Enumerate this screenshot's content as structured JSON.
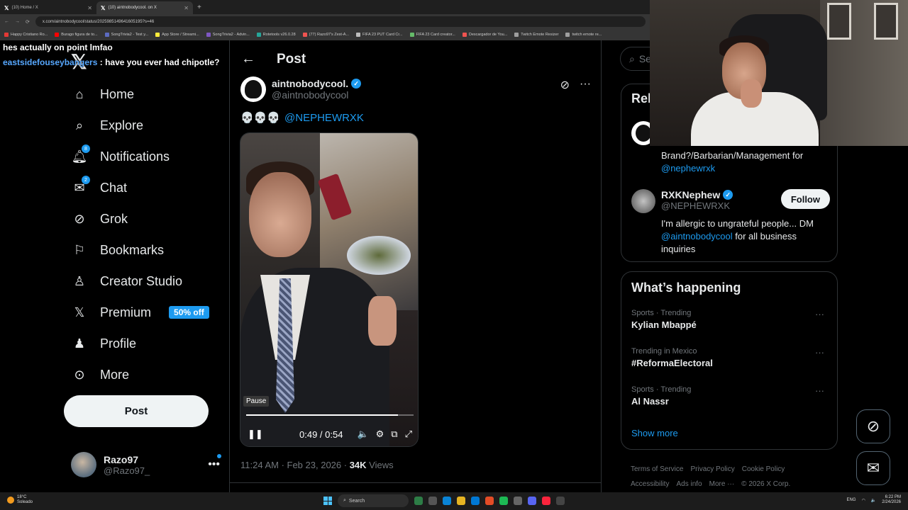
{
  "browser": {
    "tabs": [
      {
        "title": "(10) Home / X"
      },
      {
        "title": "(10) aintnobodycool. on X"
      }
    ],
    "url": "x.com/aintnobodycool/status/2025985149641605195?s=46",
    "bookmarks": [
      {
        "label": "Happy Cristiano Ro...",
        "color": "#e53935"
      },
      {
        "label": "Burago figura de to...",
        "color": "#ff0000"
      },
      {
        "label": "SongTrivia2 - Test y...",
        "color": "#5c6bc0"
      },
      {
        "label": "App Store / Streami...",
        "color": "#ffeb3b"
      },
      {
        "label": "SongTrivia2 - Advin...",
        "color": "#7e57c2"
      },
      {
        "label": "Rotetools v26.0.28",
        "color": "#26a69a"
      },
      {
        "label": "(77) Razo97's Zest-A...",
        "color": "#ef5350"
      },
      {
        "label": "FIFA 23 PUT Card Cr...",
        "color": "#bdbdbd"
      },
      {
        "label": "FIFA 23 Card creator...",
        "color": "#66bb6a"
      },
      {
        "label": "Descargador de You...",
        "color": "#ef5350"
      },
      {
        "label": "Twitch Emote Resizer",
        "color": "#9e9e9e"
      },
      {
        "label": "twitch emote re...",
        "color": "#9e9e9e"
      }
    ]
  },
  "chat_overlay": [
    {
      "user": "",
      "text": "hes actually on point lmfao"
    },
    {
      "user": "eastsidefouseybangers",
      "text": ": have you ever had chipotle?"
    }
  ],
  "nav": {
    "items": [
      {
        "label": "Home",
        "icon": "home-icon",
        "badge": ""
      },
      {
        "label": "Explore",
        "icon": "search-icon",
        "badge": ""
      },
      {
        "label": "Notifications",
        "icon": "bell-icon",
        "badge": "8"
      },
      {
        "label": "Chat",
        "icon": "mail-icon",
        "badge": "2"
      },
      {
        "label": "Grok",
        "icon": "grok-icon",
        "badge": ""
      },
      {
        "label": "Bookmarks",
        "icon": "bookmark-icon",
        "badge": ""
      },
      {
        "label": "Creator Studio",
        "icon": "creator-icon",
        "badge": ""
      },
      {
        "label": "Premium",
        "icon": "x-icon",
        "badge": ""
      },
      {
        "label": "Profile",
        "icon": "person-icon",
        "badge": ""
      },
      {
        "label": "More",
        "icon": "more-circle-icon",
        "badge": ""
      }
    ],
    "premium_promo": "50% off",
    "post_button": "Post",
    "account": {
      "name": "Razo97",
      "handle": "@Razo97_"
    }
  },
  "post": {
    "header_title": "Post",
    "author_name": "aintnobodycool.",
    "author_handle": "@aintnobodycool",
    "emoji": "💀💀💀",
    "mention": "@NEPHEWRXK",
    "video": {
      "pause_label": "Pause",
      "time": "0:49 / 0:54",
      "progress": 0.907
    },
    "timestamp": "11:24 AM · Feb 23, 2026 · ",
    "views_count": "34K",
    "views_label": " Views"
  },
  "right": {
    "search_placeholder": "Se",
    "relevant_title": "Rel",
    "person1_bio_text": "Brand?/Barbarian/Management for",
    "person1_bio_link": "@nephewrxk",
    "person2": {
      "name": "RXKNephew",
      "handle": "@NEPHEWRXK",
      "follow": "Follow",
      "bio_start": "I'm allergic to ungrateful people... DM",
      "bio_link": "@aintnobodycool",
      "bio_end": " for all business inquiries"
    },
    "trends_title": "What’s happening",
    "trends": [
      {
        "meta": "Sports · Trending",
        "name": "Kylian Mbappé"
      },
      {
        "meta": "Trending in Mexico",
        "name": "#ReformaElectoral"
      },
      {
        "meta": "Sports · Trending",
        "name": "Al Nassr"
      }
    ],
    "show_more": "Show more",
    "footer": [
      "Terms of Service",
      "Privacy Policy",
      "Cookie Policy",
      "Accessibility",
      "Ads info",
      "More ···",
      "© 2026 X Corp."
    ]
  },
  "taskbar": {
    "temp": "18°C",
    "weather": "Soleado",
    "search": "Search",
    "lang": "ENG",
    "time": "6:22 PM",
    "date": "2/24/2026"
  },
  "colors": {
    "accent": "#1d9bf0",
    "background": "#000000",
    "border": "#2f3336",
    "muted": "#71767b"
  }
}
